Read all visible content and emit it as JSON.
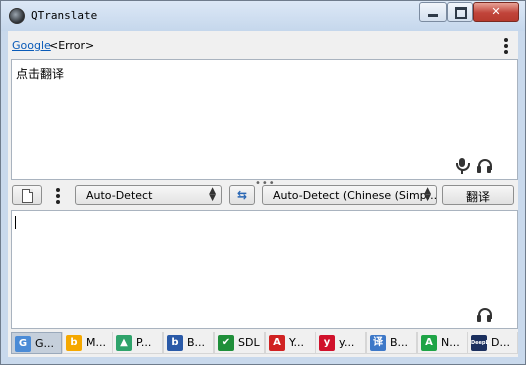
{
  "window": {
    "title": "QTranslate",
    "min_glyph": "",
    "max_glyph": "",
    "close_glyph": "✕"
  },
  "source": {
    "service_link": "Google",
    "status": "<Error>",
    "text": "点击翻译"
  },
  "controls": {
    "source_language": "Auto-Detect",
    "target_language": "Auto-Detect (Chinese (Simp...",
    "swap_glyph": "⇆",
    "translate_label": "翻译"
  },
  "splitter": "•••",
  "services": [
    {
      "short": "G...",
      "icon_text": "G",
      "icon_color": "#4b8bd6"
    },
    {
      "short": "M...",
      "icon_text": "b",
      "icon_color": "#f5a800"
    },
    {
      "short": "P...",
      "icon_text": "▲",
      "icon_color": "#2fa36b"
    },
    {
      "short": "B...",
      "icon_text": "b",
      "icon_color": "#2a5aa8"
    },
    {
      "short": "SDL",
      "icon_text": "✔",
      "icon_color": "#1f8f3a"
    },
    {
      "short": "Y...",
      "icon_text": "A",
      "icon_color": "#d02222"
    },
    {
      "short": "y...",
      "icon_text": "y",
      "icon_color": "#d0112b"
    },
    {
      "short": "B...",
      "icon_text": "译",
      "icon_color": "#3d78c8"
    },
    {
      "short": "N...",
      "icon_text": "A",
      "icon_color": "#1ea446"
    },
    {
      "short": "D...",
      "icon_text": "DeepL",
      "icon_color": "#1b2f5e"
    }
  ]
}
